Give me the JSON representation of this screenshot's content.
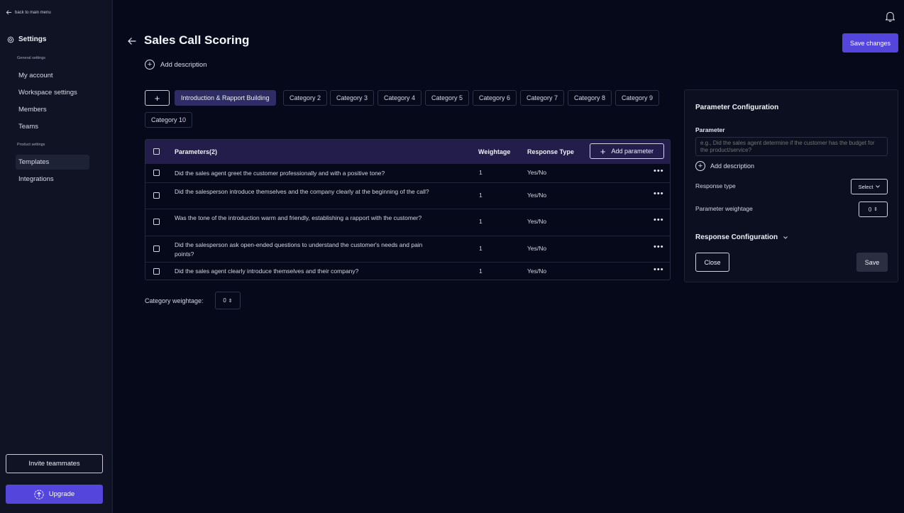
{
  "sidebar": {
    "back_label": "back to main menu",
    "settings_title": "Settings",
    "general_section": "General settings",
    "general_items": [
      "My account",
      "Workspace settings",
      "Members",
      "Teams"
    ],
    "product_section": "Product settings",
    "product_items": [
      "Templates",
      "Integrations"
    ],
    "active_item": "Templates",
    "invite_label": "Invite teammates",
    "upgrade_label": "Upgrade"
  },
  "header": {
    "title": "Sales Call Scoring",
    "add_description": "Add description",
    "save_changes": "Save changes"
  },
  "categories": {
    "add_symbol": "+",
    "tabs": [
      "Introduction & Rapport Building",
      "Category 2",
      "Category 3",
      "Category 4",
      "Category 5",
      "Category 6",
      "Category 7",
      "Category 8",
      "Category 9",
      "Category 10"
    ],
    "active": "Introduction & Rapport Building"
  },
  "table": {
    "columns": {
      "parameters": "Parameters(2)",
      "weightage": "Weightage",
      "response_type": "Response Type"
    },
    "add_parameter": "Add parameter",
    "rows": [
      {
        "question": "Did the sales agent greet the customer professionally and with a positive tone?",
        "weightage": "1",
        "response": "Yes/No"
      },
      {
        "question": "Did the salesperson introduce themselves and the company clearly at the beginning of the call?",
        "weightage": "1",
        "response": "Yes/No"
      },
      {
        "question": "Was the tone of the introduction warm and friendly, establishing a rapport with the customer?",
        "weightage": "1",
        "response": "Yes/No"
      },
      {
        "question": "Did the salesperson ask open-ended questions to understand the customer's needs and pain points?",
        "weightage": "1",
        "response": "Yes/No"
      },
      {
        "question": "Did the sales agent clearly introduce themselves and their company?",
        "weightage": "1",
        "response": "Yes/No"
      }
    ]
  },
  "category_weightage": {
    "label": "Category weightage:",
    "value": "0"
  },
  "panel": {
    "title": "Parameter Configuration",
    "parameter_label": "Parameter",
    "parameter_placeholder": "e.g., Did the sales agent determine if the customer has the budget for the product/service?",
    "add_description": "Add description",
    "response_type_label": "Response type",
    "response_type_value": "Select",
    "weightage_label": "Parameter weightage",
    "weightage_value": "0",
    "response_config": "Response Configuration",
    "close_label": "Close",
    "save_label": "Save"
  },
  "colors": {
    "background": "#06091a",
    "sidebar": "#0f1324",
    "accent": "#5446dc",
    "table_header": "#221d4a",
    "active_tab": "#2d2d63"
  },
  "icons": {
    "back": "arrow-left-icon",
    "settings": "gear-icon",
    "notifications": "bell-icon",
    "add": "plus-icon",
    "upgrade": "arrow-up-circle-icon",
    "more": "more-horizontal-icon",
    "chevron": "chevron-down-icon",
    "stepper": "up-down-icon"
  }
}
